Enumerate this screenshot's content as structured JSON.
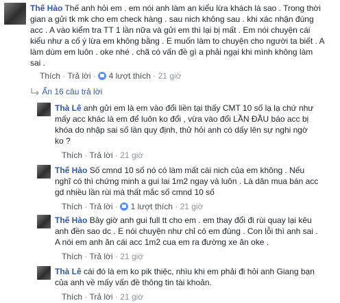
{
  "comments": [
    {
      "author": "Thế Hào",
      "lines": [
        "Thế anh hỏi em . em nói anh làm an kiểu lừa khách là sao . Trong thời",
        "gian a gửi tk mk cho em check hàng . sau nich không sau . khi xác nhận đúng",
        "acc . A vào kiểm tra TT 1 lần nữa và gửi em thì lại bị mất . Em nói chuyện cái",
        "kiểu như a cố ý lừa em không bằng . E muốn làm to chuyện cho người ta biết . A",
        "làm dùm em luôn . oke nhé . chã có vấn đề gì a phải ngại khi mình không làm",
        "sai ."
      ],
      "actions": {
        "like": "Thích",
        "reply": "Trả lời",
        "replies": "4 lượt thích",
        "time": "21 giờ"
      }
    },
    {
      "author": "Thà Lê",
      "lines": [
        "anh gửi em là em vào đổi liền tại thấy CMT 10 số lạ lạ chứ như",
        "mấy acc khác là em để luôn ko đổi , vừa vào đổi LẦN ĐẦU báo acc bị",
        "khóa do nhập sai số lần quy định, thử hỏi anh có dấy lên sự nghi ngờ",
        "ko ?"
      ],
      "actions": {
        "like": "Thích",
        "reply": "Trả lời",
        "time": "21 giờ"
      }
    },
    {
      "author": "Thế Hào",
      "lines": [
        "Số cmnd 10 số nó có làm mất cái nich của em không . Nếu",
        "nghĩ có thì chứng minh a gui lai 1m2 ngay và luôn . Là dân mua bán acc",
        "gd nhiều lần rùi mà thất mắc số cmnd 10 số"
      ],
      "actions": {
        "like": "Thích",
        "reply": "Trả lời",
        "replies": "1 lượt thích",
        "time": "21 giờ"
      }
    },
    {
      "author": "Thế Hào",
      "lines": [
        "Bây giờ anh gui full tt cho em . em thay đổi đi rùi quay lại kêu",
        "anh đền sao dc . E nói chuyện như chỉ có em đúng . Con lỗi thì anh sai .",
        "A nói em anh ăn cái acc 1m2 cua em ra đường xe ăn oke ."
      ],
      "actions": {
        "like": "Thích",
        "reply": "Trả lời",
        "time": "21 giờ"
      }
    },
    {
      "author": "Thà Lê",
      "lines": [
        "cái đó là em ko pik thiệc, nhìu khi em phải đi hỏi anh Giang bạn",
        "của anh về mấy vấn đề thông tin tài khoản."
      ],
      "actions": {
        "like": "Thích",
        "reply": "Trả lời",
        "time": "21 giờ"
      }
    }
  ],
  "replies_toggle": "Ẩn 16 câu trả lời",
  "separator": "·"
}
